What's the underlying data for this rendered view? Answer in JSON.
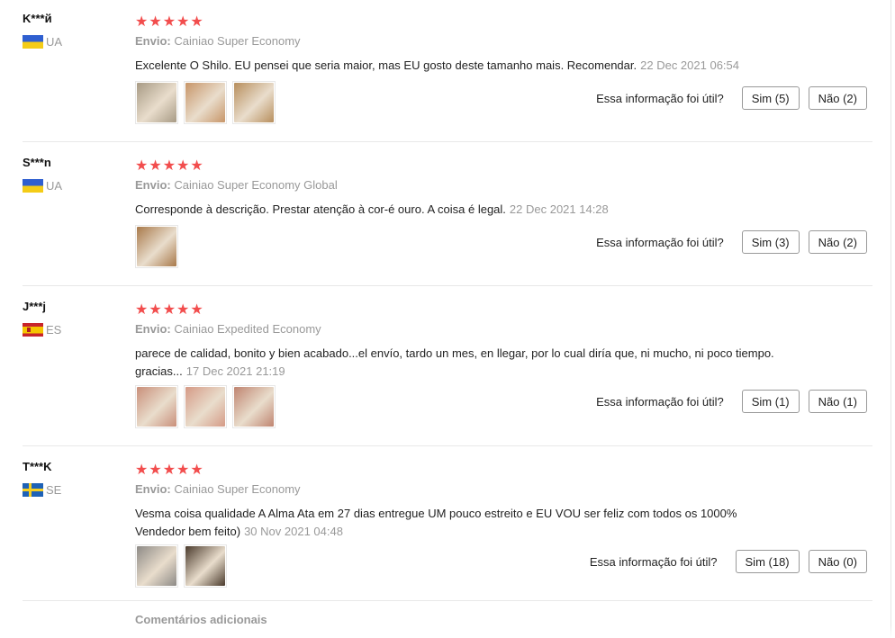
{
  "reviews": [
    {
      "user": "K***й",
      "country": "UA",
      "flag": "ua",
      "stars": 5,
      "ship_label": "Envio:",
      "ship_method": "Cainiao Super Economy",
      "text": "Excelente O Shilo. EU pensei que seria maior, mas EU gosto deste tamanho mais. Recomendar.",
      "date": "22 Dec 2021 06:54",
      "photos": [
        "#a79a84",
        "#c79568",
        "#b78e5c"
      ],
      "helpful_q": "Essa informação foi útil?",
      "yes": "Sim (5)",
      "no": "Não (2)"
    },
    {
      "user": "S***n",
      "country": "UA",
      "flag": "ua",
      "stars": 5,
      "ship_label": "Envio:",
      "ship_method": "Cainiao Super Economy Global",
      "text": "Corresponde à descrição. Prestar atenção à cor-é ouro. A coisa é legal.",
      "date": "22 Dec 2021 14:28",
      "photos": [
        "#a8794a"
      ],
      "helpful_q": "Essa informação foi útil?",
      "yes": "Sim (3)",
      "no": "Não (2)"
    },
    {
      "user": "J***j",
      "country": "ES",
      "flag": "es",
      "stars": 5,
      "ship_label": "Envio:",
      "ship_method": "Cainiao Expedited Economy",
      "text": "parece de calidad, bonito y bien acabado...el envío, tardo un mes, en llegar, por lo cual diría que, ni mucho, ni poco tiempo. gracias...",
      "date": "17 Dec 2021 21:19",
      "photos": [
        "#c98f7a",
        "#d59a86",
        "#bf8470"
      ],
      "helpful_q": "Essa informação foi útil?",
      "yes": "Sim (1)",
      "no": "Não (1)"
    },
    {
      "user": "T***K",
      "country": "SE",
      "flag": "se",
      "stars": 5,
      "ship_label": "Envio:",
      "ship_method": "Cainiao Super Economy",
      "text": "Vesma coisa qualidade A Alma Ata em 27 dias entregue UM pouco estreito e EU VOU ser feliz com todos os 1000% Vendedor bem feito)",
      "date": "30 Nov 2021 04:48",
      "photos": [
        "#8d8a86",
        "#4a3a2c"
      ],
      "helpful_q": "Essa informação foi útil?",
      "yes": "Sim (18)",
      "no": "Não (0)"
    }
  ],
  "more_label": "Comentários adicionais"
}
